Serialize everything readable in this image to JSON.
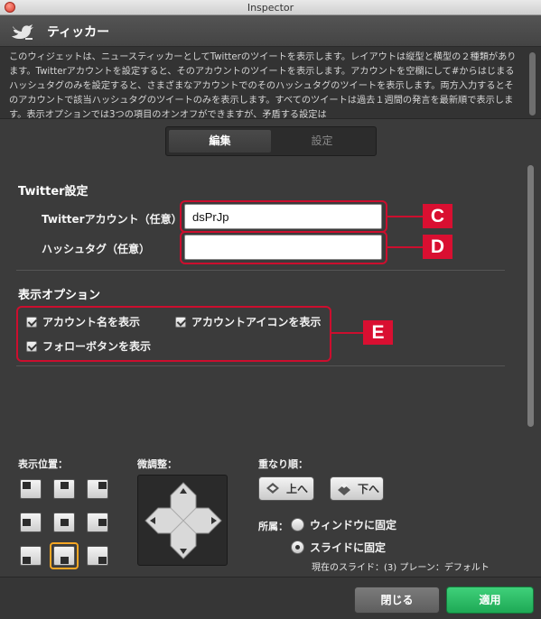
{
  "window": {
    "title": "Inspector"
  },
  "header": {
    "title": "ティッカー",
    "icon": "twitter-bird-icon"
  },
  "description": "このウィジェットは、ニュースティッカーとしてTwitterのツイートを表示します。レイアウトは縦型と横型の２種類があります。Twitterアカウントを設定すると、そのアカウントのツイートを表示します。アカウントを空欄にして#からはじまるハッシュタグのみを設定すると、さまざまなアカウントでのそのハッシュタグのツイートを表示します。両方入力するとそのアカウントで該当ハッシュタグのツイートのみを表示します。すべてのツイートは過去１週間の発言を最新順で表示します。表示オプションでは3つの項目のオンオフができますが、矛盾する設定は",
  "tabs": [
    {
      "label": "編集",
      "active": true
    },
    {
      "label": "設定",
      "active": false
    }
  ],
  "twitter_settings": {
    "section_title": "Twitter設定",
    "account_label": "Twitterアカウント（任意）",
    "account_value": "dsPrJp",
    "hashtag_label": "ハッシュタグ（任意）",
    "hashtag_value": ""
  },
  "markers": {
    "c": "C",
    "d": "D",
    "e": "E"
  },
  "display_options": {
    "section_title": "表示オプション",
    "options": [
      {
        "label": "アカウント名を表示",
        "checked": true
      },
      {
        "label": "アカウントアイコンを表示",
        "checked": true
      },
      {
        "label": "フォローボタンを表示",
        "checked": true
      }
    ]
  },
  "position": {
    "label": "表示位置：",
    "selected": "bottom-center"
  },
  "nudge": {
    "label": "微調整："
  },
  "stacking": {
    "label": "重なり順：",
    "up_label": "上へ",
    "down_label": "下へ"
  },
  "affiliation": {
    "label": "所属：",
    "window_label": "ウィンドウに固定",
    "slide_label": "スライドに固定",
    "selected": "slide",
    "current_slide": "現在のスライド：(3) プレーン：デフォルト"
  },
  "footer": {
    "close_label": "閉じる",
    "apply_label": "適用"
  },
  "colors": {
    "accent_green": "#1ea955",
    "marker_red": "#d90f31",
    "selection_orange": "#f5a623"
  }
}
